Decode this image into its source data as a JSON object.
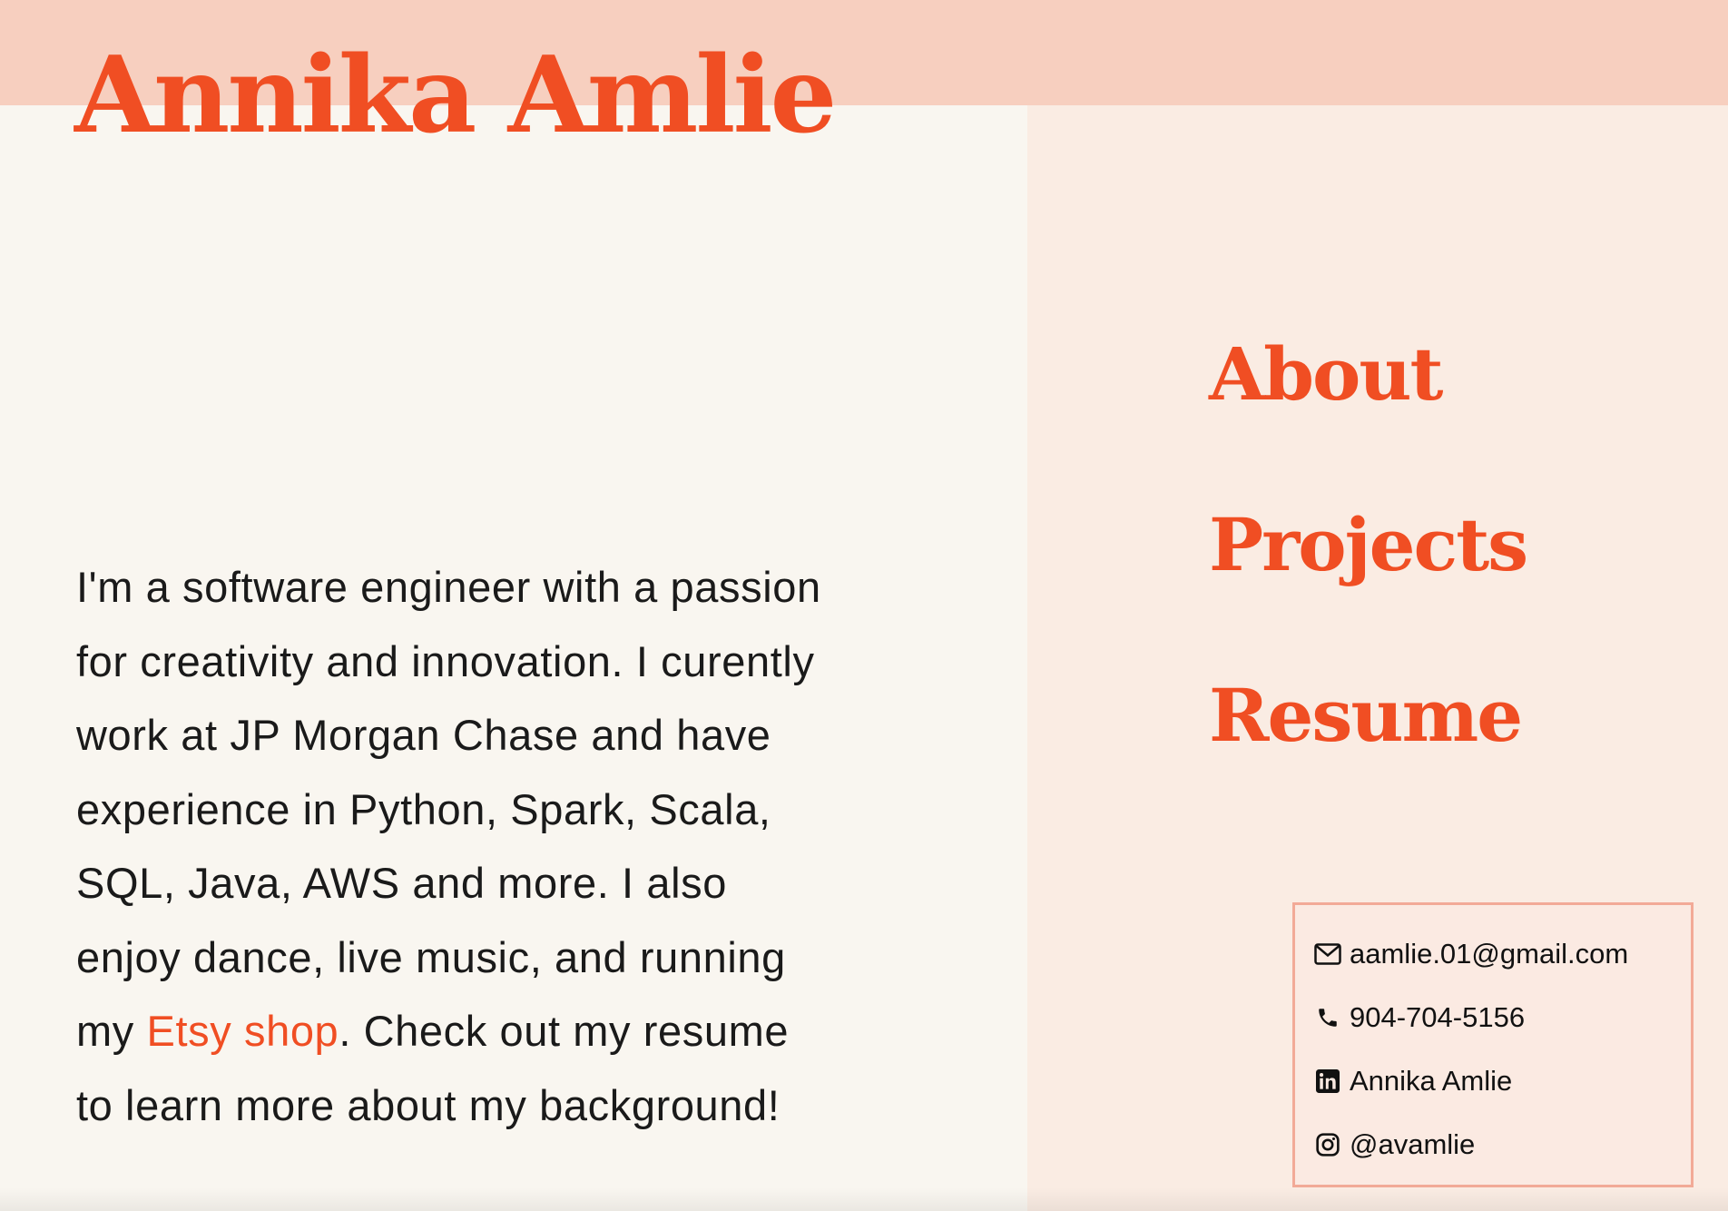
{
  "header": {
    "name": "Annika Amlie"
  },
  "bio": {
    "text_before": "I'm a software engineer with a passion for creativity and innovation. I curently work at JP Morgan Chase and have experience in Python, Spark, Scala, SQL, Java, AWS and more. I also enjoy dance, live music, and running my ",
    "link_text": "Etsy shop",
    "text_after": ". Check out my resume to learn more about my background!"
  },
  "nav": {
    "items": [
      {
        "label": "About"
      },
      {
        "label": "Projects"
      },
      {
        "label": "Resume"
      }
    ]
  },
  "contact": {
    "email": "aamlie.01@gmail.com",
    "phone": "904-704-5156",
    "linkedin": "Annika Amlie",
    "instagram": "@avamlie",
    "icons": [
      "envelope-icon",
      "phone-icon",
      "linkedin-icon",
      "instagram-icon"
    ]
  },
  "colors": {
    "accent": "#f04e23",
    "top_band": "#f7cfbf",
    "left_bg": "#f9f6f0",
    "right_bg": "#faece3",
    "contact_border": "#f2aa97"
  }
}
